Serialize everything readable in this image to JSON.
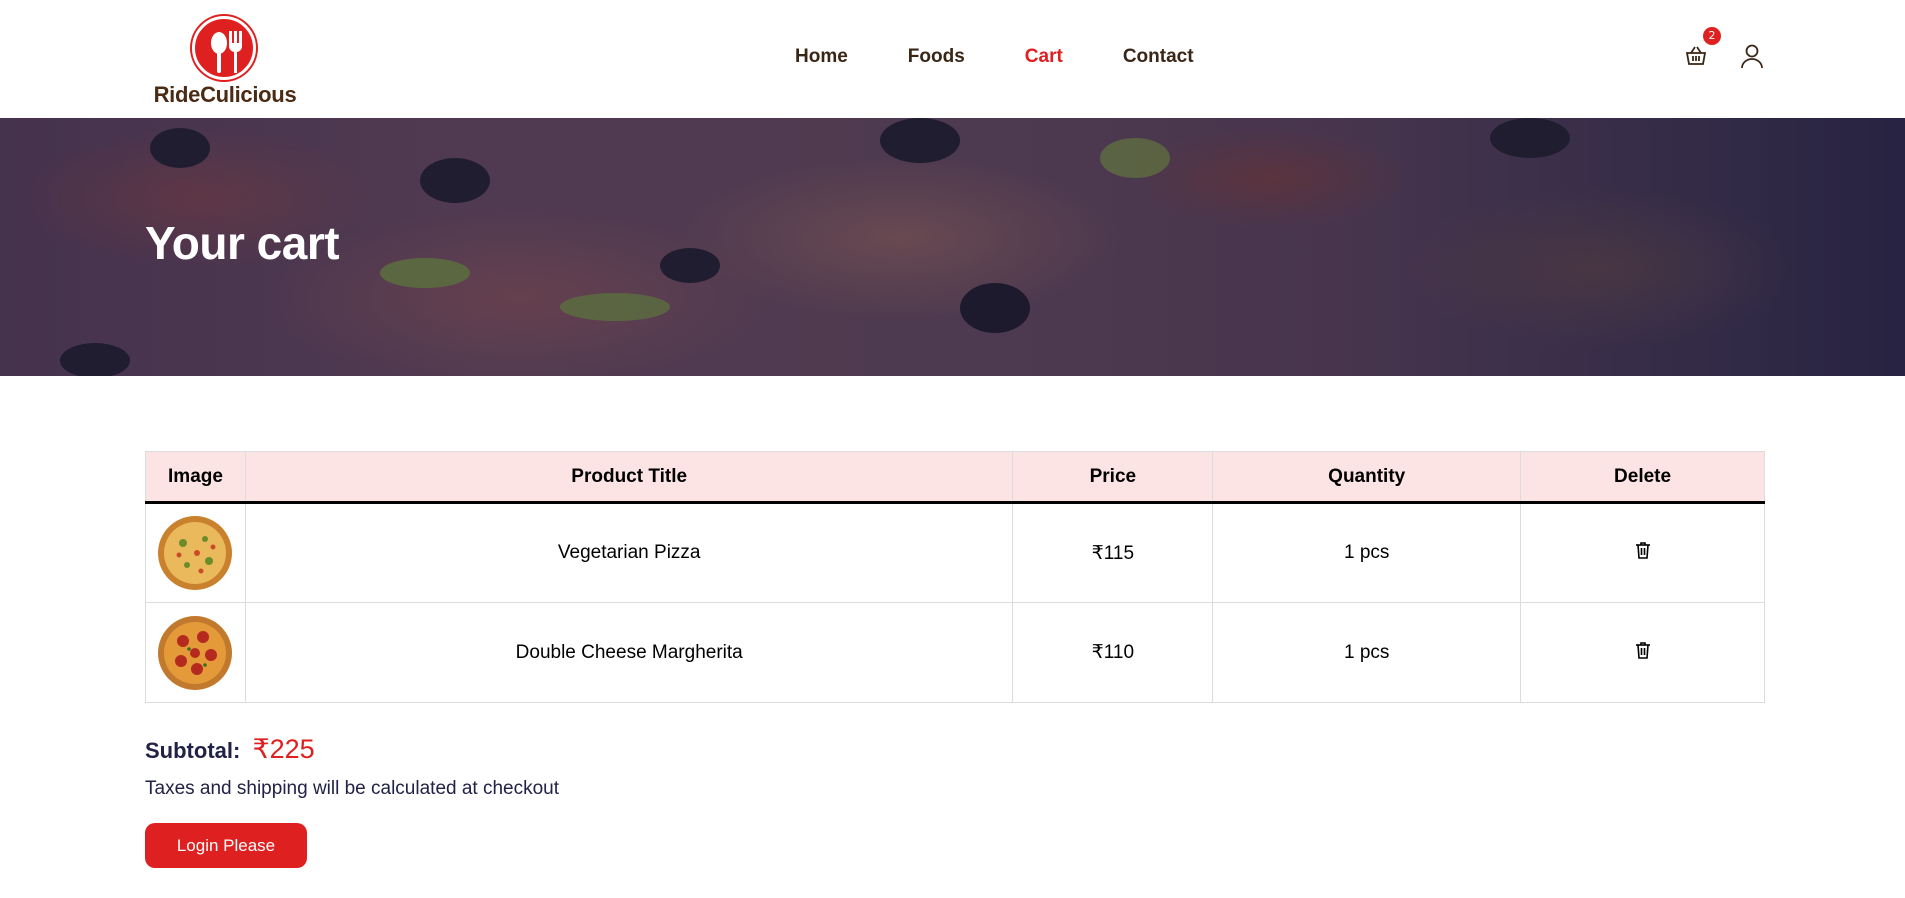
{
  "brand": {
    "name": "RideCulicious"
  },
  "nav": {
    "items": [
      "Home",
      "Foods",
      "Cart",
      "Contact"
    ],
    "active": "Cart"
  },
  "header_icons": {
    "cart_icon": "shopping-basket-icon",
    "cart_count": "2",
    "user_icon": "user-icon"
  },
  "banner": {
    "title": "Your cart"
  },
  "table": {
    "headers": [
      "Image",
      "Product Title",
      "Price",
      "Quantity",
      "Delete"
    ],
    "rows": [
      {
        "image": "vegetarian-pizza-thumbnail",
        "title": "Vegetarian Pizza",
        "price": "₹115",
        "quantity": "1 pcs",
        "delete_icon": "trash-icon"
      },
      {
        "image": "pepperoni-pizza-thumbnail",
        "title": "Double Cheese Margherita",
        "price": "₹110",
        "quantity": "1 pcs",
        "delete_icon": "trash-icon"
      }
    ]
  },
  "summary": {
    "subtotal_label": "Subtotal:",
    "subtotal_value": "₹225",
    "note": "Taxes and shipping will be calculated at checkout",
    "button_label": "Login Please"
  },
  "colors": {
    "accent": "#df2020",
    "header_bg": "#fde4e4",
    "text": "#212245"
  }
}
